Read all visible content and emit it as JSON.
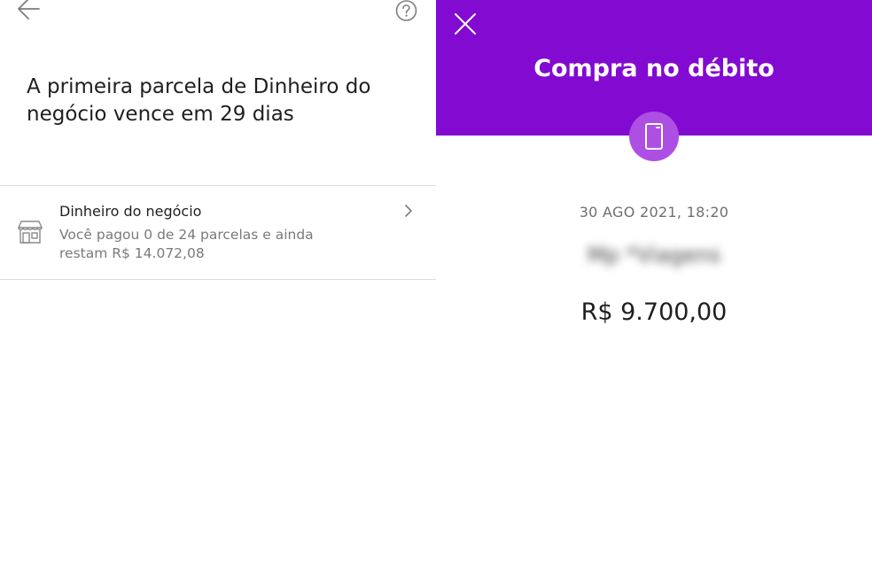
{
  "left_screen": {
    "headline": "A primeira parcela de Dinheiro do negócio vence em 29 dias",
    "loan_item": {
      "title": "Dinheiro do negócio",
      "description": "Você pagou 0 de 24 parcelas e ainda restam R$ 14.072,08",
      "icon": "store-icon"
    },
    "icons": {
      "back": "arrow-left-icon",
      "help": "question-circle-icon",
      "chevron": "chevron-right-icon"
    }
  },
  "right_screen": {
    "title": "Compra no débito",
    "datetime": "30 AGO 2021, 18:20",
    "merchant": "Mp *Viagens",
    "amount": "R$ 9.700,00",
    "icons": {
      "close": "close-icon",
      "badge": "card-icon"
    }
  },
  "colors": {
    "brand_purple": "#820ad1",
    "badge_purple": "#ad4fe3",
    "divider": "#dcdcdc",
    "text_primary": "#1f1f1f",
    "text_secondary": "#7a7a7a"
  }
}
